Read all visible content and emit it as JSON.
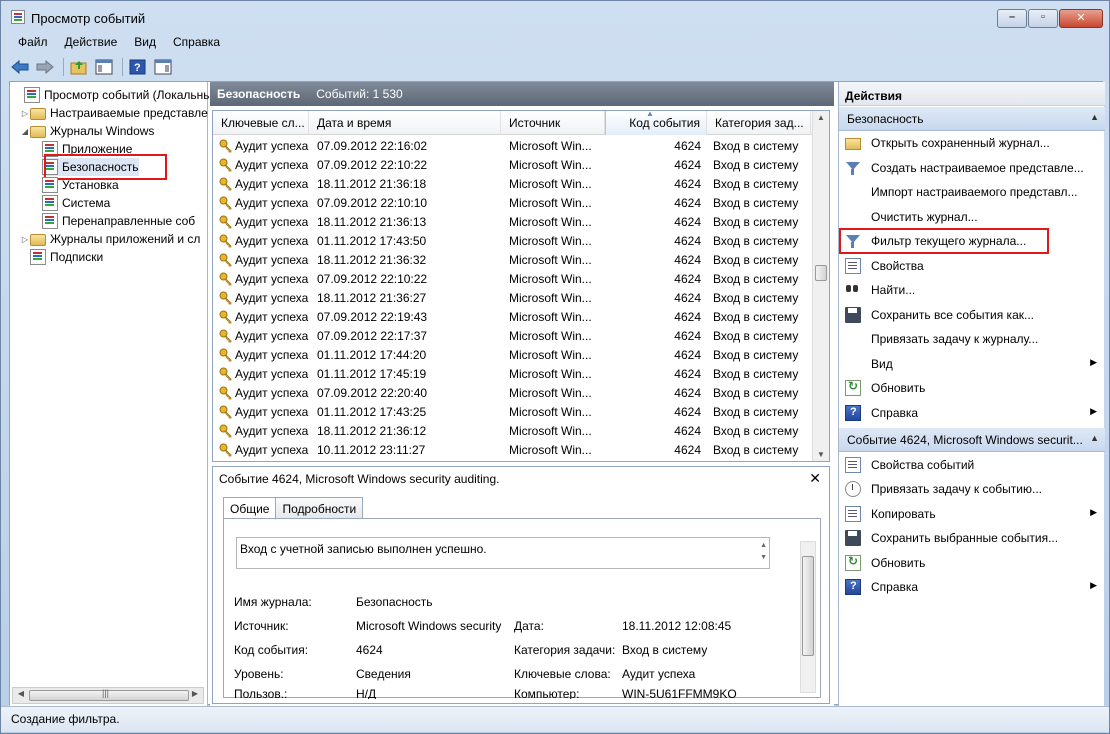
{
  "window": {
    "title": "Просмотр событий",
    "buttons": {
      "minimize": "–",
      "maximize": "▫",
      "close": "✕"
    }
  },
  "menu": [
    "Файл",
    "Действие",
    "Вид",
    "Справка"
  ],
  "toolbar": {
    "items": [
      "back-icon",
      "forward-icon",
      "folder-up-icon",
      "show-hide-tree-icon",
      "help-icon",
      "show-hide-actions-icon"
    ]
  },
  "tree": {
    "items": [
      {
        "label": "Просмотр событий (Локальны",
        "indent": 0,
        "arrow": "",
        "icon": "log"
      },
      {
        "label": "Настраиваемые представле",
        "indent": 1,
        "arrow": "▷",
        "icon": "folder"
      },
      {
        "label": "Журналы Windows",
        "indent": 1,
        "arrow": "◢",
        "icon": "folder"
      },
      {
        "label": "Приложение",
        "indent": 2,
        "arrow": "",
        "icon": "log"
      },
      {
        "label": "Безопасность",
        "indent": 2,
        "arrow": "",
        "icon": "log"
      },
      {
        "label": "Установка",
        "indent": 2,
        "arrow": "",
        "icon": "log"
      },
      {
        "label": "Система",
        "indent": 2,
        "arrow": "",
        "icon": "log"
      },
      {
        "label": "Перенаправленные соб",
        "indent": 2,
        "arrow": "",
        "icon": "log"
      },
      {
        "label": "Журналы приложений и сл",
        "indent": 1,
        "arrow": "▷",
        "icon": "folder"
      },
      {
        "label": "Подписки",
        "indent": 1,
        "arrow": "",
        "icon": "log"
      }
    ]
  },
  "middle": {
    "header_name": "Безопасность",
    "header_count": "Событий: 1 530",
    "columns": [
      "Ключевые сл...",
      "Дата и время",
      "Источник",
      "Код события",
      "Категория зад..."
    ],
    "rows": [
      [
        "Аудит успеха",
        "07.09.2012 22:16:02",
        "Microsoft Win...",
        "4624",
        "Вход в систему"
      ],
      [
        "Аудит успеха",
        "07.09.2012 22:10:22",
        "Microsoft Win...",
        "4624",
        "Вход в систему"
      ],
      [
        "Аудит успеха",
        "18.11.2012 21:36:18",
        "Microsoft Win...",
        "4624",
        "Вход в систему"
      ],
      [
        "Аудит успеха",
        "07.09.2012 22:10:10",
        "Microsoft Win...",
        "4624",
        "Вход в систему"
      ],
      [
        "Аудит успеха",
        "18.11.2012 21:36:13",
        "Microsoft Win...",
        "4624",
        "Вход в систему"
      ],
      [
        "Аудит успеха",
        "01.11.2012 17:43:50",
        "Microsoft Win...",
        "4624",
        "Вход в систему"
      ],
      [
        "Аудит успеха",
        "18.11.2012 21:36:32",
        "Microsoft Win...",
        "4624",
        "Вход в систему"
      ],
      [
        "Аудит успеха",
        "07.09.2012 22:10:22",
        "Microsoft Win...",
        "4624",
        "Вход в систему"
      ],
      [
        "Аудит успеха",
        "18.11.2012 21:36:27",
        "Microsoft Win...",
        "4624",
        "Вход в систему"
      ],
      [
        "Аудит успеха",
        "07.09.2012 22:19:43",
        "Microsoft Win...",
        "4624",
        "Вход в систему"
      ],
      [
        "Аудит успеха",
        "07.09.2012 22:17:37",
        "Microsoft Win...",
        "4624",
        "Вход в систему"
      ],
      [
        "Аудит успеха",
        "01.11.2012 17:44:20",
        "Microsoft Win...",
        "4624",
        "Вход в систему"
      ],
      [
        "Аудит успеха",
        "01.11.2012 17:45:19",
        "Microsoft Win...",
        "4624",
        "Вход в систему"
      ],
      [
        "Аудит успеха",
        "07.09.2012 22:20:40",
        "Microsoft Win...",
        "4624",
        "Вход в систему"
      ],
      [
        "Аудит успеха",
        "01.11.2012 17:43:25",
        "Microsoft Win...",
        "4624",
        "Вход в систему"
      ],
      [
        "Аудит успеха",
        "18.11.2012 21:36:12",
        "Microsoft Win...",
        "4624",
        "Вход в систему"
      ],
      [
        "Аудит успеха",
        "10.11.2012 23:11:27",
        "Microsoft Win...",
        "4624",
        "Вход в систему"
      ]
    ]
  },
  "detail": {
    "title": "Событие 4624, Microsoft Windows security auditing.",
    "close": "✕",
    "tabs": [
      "Общие",
      "Подробности"
    ],
    "message": "Вход с учетной записью выполнен успешно.",
    "fields": {
      "log_name_label": "Имя журнала:",
      "log_name": "Безопасность",
      "source_label": "Источник:",
      "source": "Microsoft Windows security",
      "date_label": "Дата:",
      "date": "18.11.2012 12:08:45",
      "event_id_label": "Код события:",
      "event_id": "4624",
      "task_cat_label": "Категория задачи:",
      "task_cat": "Вход в систему",
      "level_label": "Уровень:",
      "level": "Сведения",
      "keywords_label": "Ключевые слова:",
      "keywords": "Аудит успеха",
      "user_label": "Пользов.:",
      "user": "Н/Д",
      "computer_label": "Компьютер:",
      "computer": "WIN-5U61FFMM9KO"
    }
  },
  "actions": {
    "title": "Действия",
    "section1": "Безопасность",
    "items1": [
      {
        "label": "Открыть сохраненный журнал...",
        "icon": "folder-open",
        "sub": false
      },
      {
        "label": "Создать настраиваемое представле...",
        "icon": "filter",
        "sub": false
      },
      {
        "label": "Импорт настраиваемого представл...",
        "icon": "",
        "sub": false
      },
      {
        "label": "Очистить журнал...",
        "icon": "",
        "sub": false
      },
      {
        "label": "Фильтр текущего журнала...",
        "icon": "filter",
        "sub": false
      },
      {
        "label": "Свойства",
        "icon": "props",
        "sub": false
      },
      {
        "label": "Найти...",
        "icon": "find",
        "sub": false
      },
      {
        "label": "Сохранить все события как...",
        "icon": "save",
        "sub": false
      },
      {
        "label": "Привязать задачу к журналу...",
        "icon": "",
        "sub": false
      },
      {
        "label": "Вид",
        "icon": "",
        "sub": true
      },
      {
        "label": "Обновить",
        "icon": "refresh",
        "sub": false
      },
      {
        "label": "Справка",
        "icon": "help",
        "sub": true
      }
    ],
    "section2": "Событие 4624, Microsoft Windows securit...",
    "items2": [
      {
        "label": "Свойства событий",
        "icon": "props",
        "sub": false
      },
      {
        "label": "Привязать задачу к событию...",
        "icon": "task",
        "sub": false
      },
      {
        "label": "Копировать",
        "icon": "props",
        "sub": true
      },
      {
        "label": "Сохранить выбранные события...",
        "icon": "save",
        "sub": false
      },
      {
        "label": "Обновить",
        "icon": "refresh",
        "sub": false
      },
      {
        "label": "Справка",
        "icon": "help",
        "sub": true
      }
    ]
  },
  "status": "Создание фильтра."
}
